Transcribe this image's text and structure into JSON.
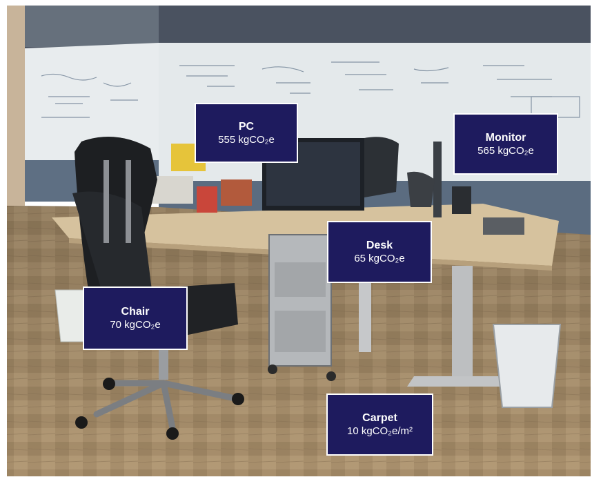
{
  "labels": {
    "pc": {
      "name": "PC",
      "value": "555 kgCO₂e"
    },
    "monitor": {
      "name": "Monitor",
      "value": "565 kgCO₂e"
    },
    "desk": {
      "name": "Desk",
      "value": "65 kgCO₂e"
    },
    "chair": {
      "name": "Chair",
      "value": "70 kgCO₂e"
    },
    "carpet": {
      "name": "Carpet",
      "value": "10 kgCO₂e/m²"
    }
  },
  "colors": {
    "label_fill": "#1e1b5e",
    "label_border": "#ffffff",
    "label_text": "#ffffff"
  }
}
